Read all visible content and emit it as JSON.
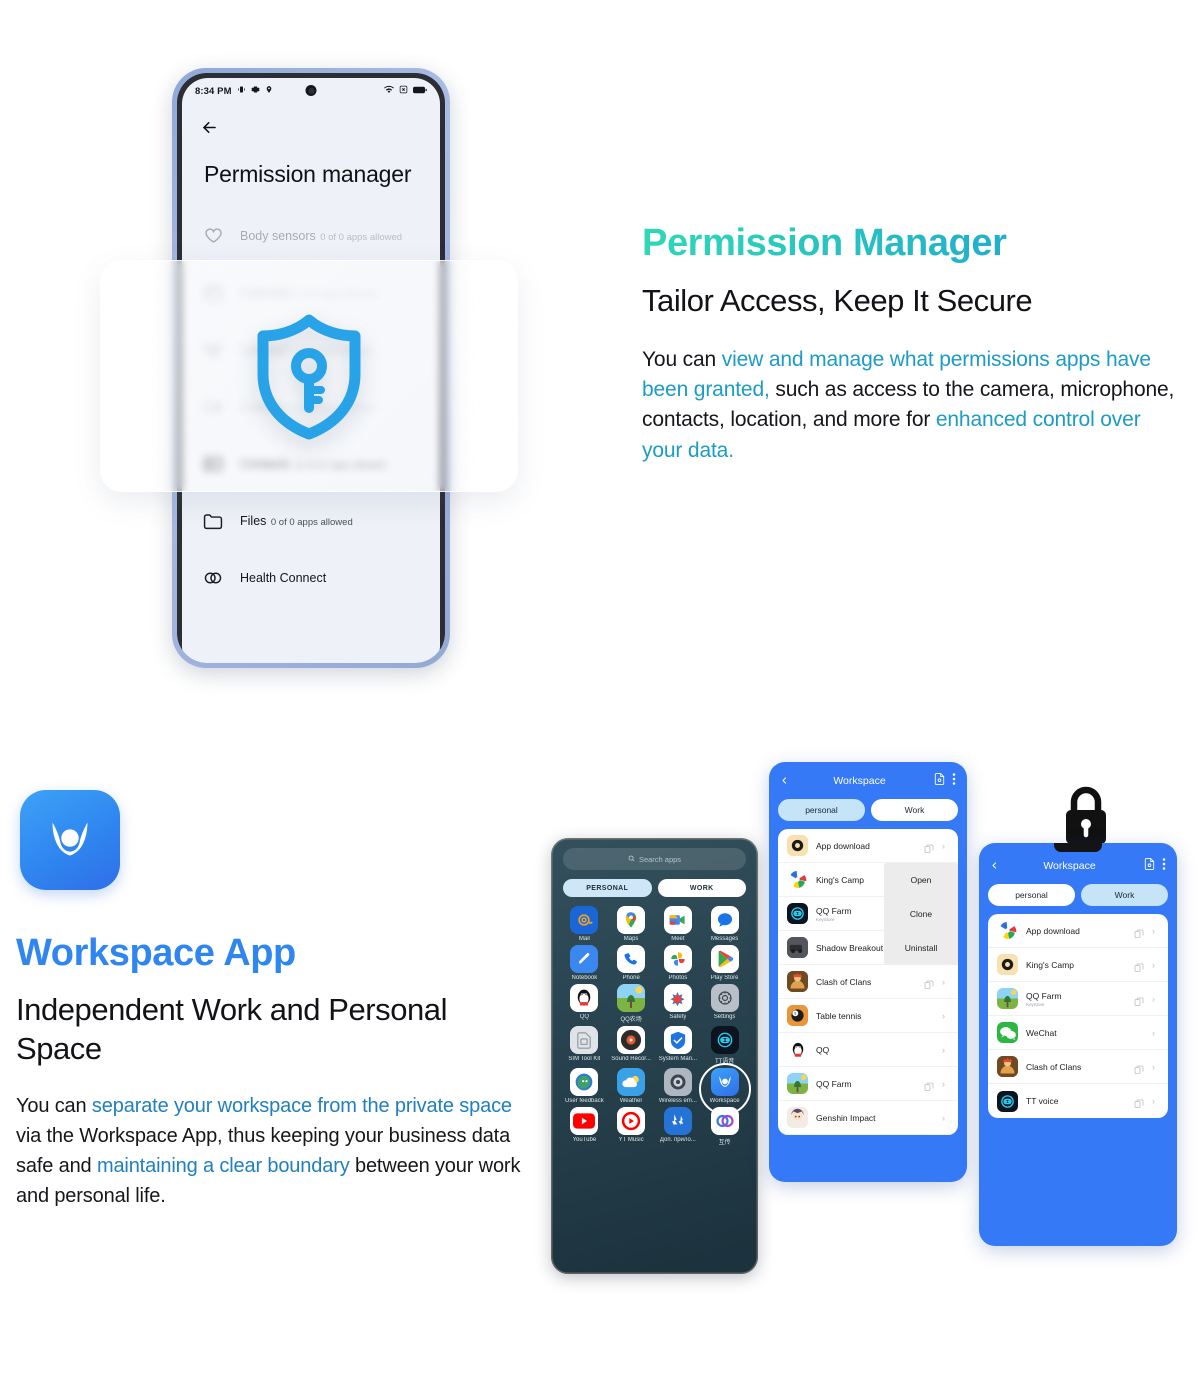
{
  "section1": {
    "title": "Permission Manager",
    "subtitle": "Tailor Access, Keep It Secure",
    "body": {
      "p1": "You can ",
      "p2": "view and manage what permissions apps have been granted,",
      "p3": " such as access to the camera, microphone, contacts, location, and more for ",
      "p4": "enhanced control over your data."
    },
    "accent_start": "#2fd8b6",
    "accent_end": "#1b9fd6",
    "phone": {
      "status_bar": {
        "time": "8:34 PM",
        "icons_left": [
          "vibrate-icon",
          "gear-icon",
          "location-pin-icon"
        ],
        "icons_right": [
          "wifi-icon",
          "no-sim-icon",
          "battery-icon"
        ]
      },
      "back_label": "back",
      "screen_title": "Permission manager",
      "permissions": [
        {
          "name": "Body sensors",
          "sub": "0 of 0 apps allowed",
          "icon": "heart-icon",
          "dimmed": true
        },
        {
          "name": "Calendar",
          "sub": "4 of 4 apps allowed",
          "icon": "calendar-icon",
          "dimmed": true
        },
        {
          "name": "Call logs",
          "sub": "6 of 6 apps allowed",
          "icon": "call-log-icon",
          "dimmed": true
        },
        {
          "name": "Camera",
          "sub": "4 of 17 apps allowed",
          "icon": "camera-icon",
          "dimmed": true
        },
        {
          "name": "Contacts",
          "sub": "11 of 21 apps allowed",
          "icon": "contacts-icon",
          "dimmed": false
        },
        {
          "name": "Files",
          "sub": "0 of 0 apps allowed",
          "icon": "folder-icon",
          "dimmed": false
        },
        {
          "name": "Health Connect",
          "sub": "",
          "icon": "health-connect-icon",
          "dimmed": false
        }
      ]
    },
    "glass_card_icon": "shield-key-icon"
  },
  "section2": {
    "logo_icon": "workspace-app-icon",
    "title": "Workspace App",
    "subtitle": "Independent Work and Personal Space",
    "body": {
      "p1": "You can ",
      "p2": "separate your workspace from the private space",
      "p3": " via the Workspace App, thus keeping your business data safe and ",
      "p4": "maintaining a clear boundary",
      "p5": " between your work and personal life."
    },
    "accent": "#2f86f0",
    "padlock_icon": "padlock-icon",
    "drawer": {
      "search_placeholder": "Search apps",
      "search_icon": "search-icon",
      "tabs": [
        {
          "label": "PERSONAL",
          "active": true
        },
        {
          "label": "WORK",
          "active": false
        }
      ],
      "apps": [
        {
          "label": "Mail",
          "icon": "mail-icon"
        },
        {
          "label": "Maps",
          "icon": "maps-icon"
        },
        {
          "label": "Meet",
          "icon": "meet-icon"
        },
        {
          "label": "Messages",
          "icon": "messages-icon"
        },
        {
          "label": "Notebook",
          "icon": "notebook-icon"
        },
        {
          "label": "Phone",
          "icon": "phone-icon"
        },
        {
          "label": "Photos",
          "icon": "photos-icon"
        },
        {
          "label": "Play Store",
          "icon": "play-store-icon"
        },
        {
          "label": "QQ",
          "icon": "qq-icon"
        },
        {
          "label": "QQ农场",
          "icon": "qq-farm-icon"
        },
        {
          "label": "Safety",
          "icon": "safety-icon"
        },
        {
          "label": "Settings",
          "icon": "settings-icon"
        },
        {
          "label": "SIM Tool Kit",
          "icon": "sim-toolkit-icon"
        },
        {
          "label": "Sound Recor...",
          "icon": "sound-recorder-icon"
        },
        {
          "label": "System Man...",
          "icon": "system-manager-icon"
        },
        {
          "label": "TT语音",
          "icon": "tt-voice-icon"
        },
        {
          "label": "User feedback",
          "icon": "user-feedback-icon"
        },
        {
          "label": "Weather",
          "icon": "weather-icon"
        },
        {
          "label": "Wireless em...",
          "icon": "wireless-emergency-icon"
        },
        {
          "label": "Workspace",
          "icon": "workspace-app-icon",
          "highlighted": true
        },
        {
          "label": "YouTube",
          "icon": "youtube-icon"
        },
        {
          "label": "YT Music",
          "icon": "yt-music-icon"
        },
        {
          "label": "Доп. прило...",
          "icon": "extra-apps-icon"
        },
        {
          "label": "互传",
          "icon": "mi-share-icon"
        }
      ]
    },
    "panel_mid": {
      "back_icon": "chevron-left-icon",
      "title": "Workspace",
      "file_icon": "file-transfer-icon",
      "menu_icon": "more-vertical-icon",
      "tabs": [
        {
          "label": "personal",
          "active": true
        },
        {
          "label": "Work",
          "active": false
        }
      ],
      "apps": [
        {
          "name": "App download",
          "sub": "",
          "icon": "app-download-icon",
          "clone": true
        },
        {
          "name": "King's Camp",
          "sub": "KeyStore",
          "icon": "kings-camp-icon",
          "clone": false
        },
        {
          "name": "QQ Farm",
          "sub": "KeyStore",
          "icon": "tt-voice-icon",
          "clone": false
        },
        {
          "name": "Shadow Breakout",
          "sub": "",
          "icon": "shadow-breakout-icon",
          "clone": false
        },
        {
          "name": "Clash of Clans",
          "sub": "",
          "icon": "clash-of-clans-icon",
          "clone": true
        },
        {
          "name": "Table tennis",
          "sub": "",
          "icon": "table-tennis-icon",
          "clone": false
        },
        {
          "name": "QQ",
          "sub": "",
          "icon": "qq-icon",
          "clone": false
        },
        {
          "name": "QQ Farm",
          "sub": "",
          "icon": "qq-farm-icon",
          "clone": true
        },
        {
          "name": "Genshin Impact",
          "sub": "",
          "icon": "genshin-icon",
          "clone": false
        }
      ],
      "context_menu": [
        "Open",
        "Clone",
        "Uninstall"
      ]
    },
    "panel_right": {
      "back_icon": "chevron-left-icon",
      "title": "Workspace",
      "file_icon": "file-transfer-icon",
      "menu_icon": "more-vertical-icon",
      "tabs": [
        {
          "label": "personal",
          "active": false
        },
        {
          "label": "Work",
          "active": true
        }
      ],
      "apps": [
        {
          "name": "App download",
          "sub": "",
          "icon": "kings-camp-icon",
          "clone": true
        },
        {
          "name": "King's Camp",
          "sub": "",
          "icon": "app-download-icon",
          "clone": true
        },
        {
          "name": "QQ Farm",
          "sub": "KeyStore",
          "icon": "qq-farm-icon",
          "clone": true
        },
        {
          "name": "WeChat",
          "sub": "",
          "icon": "wechat-icon",
          "clone": false
        },
        {
          "name": "Clash of Clans",
          "sub": "",
          "icon": "clash-of-clans-icon",
          "clone": true
        },
        {
          "name": "TT voice",
          "sub": "",
          "icon": "tt-voice-icon",
          "clone": true
        }
      ]
    }
  }
}
